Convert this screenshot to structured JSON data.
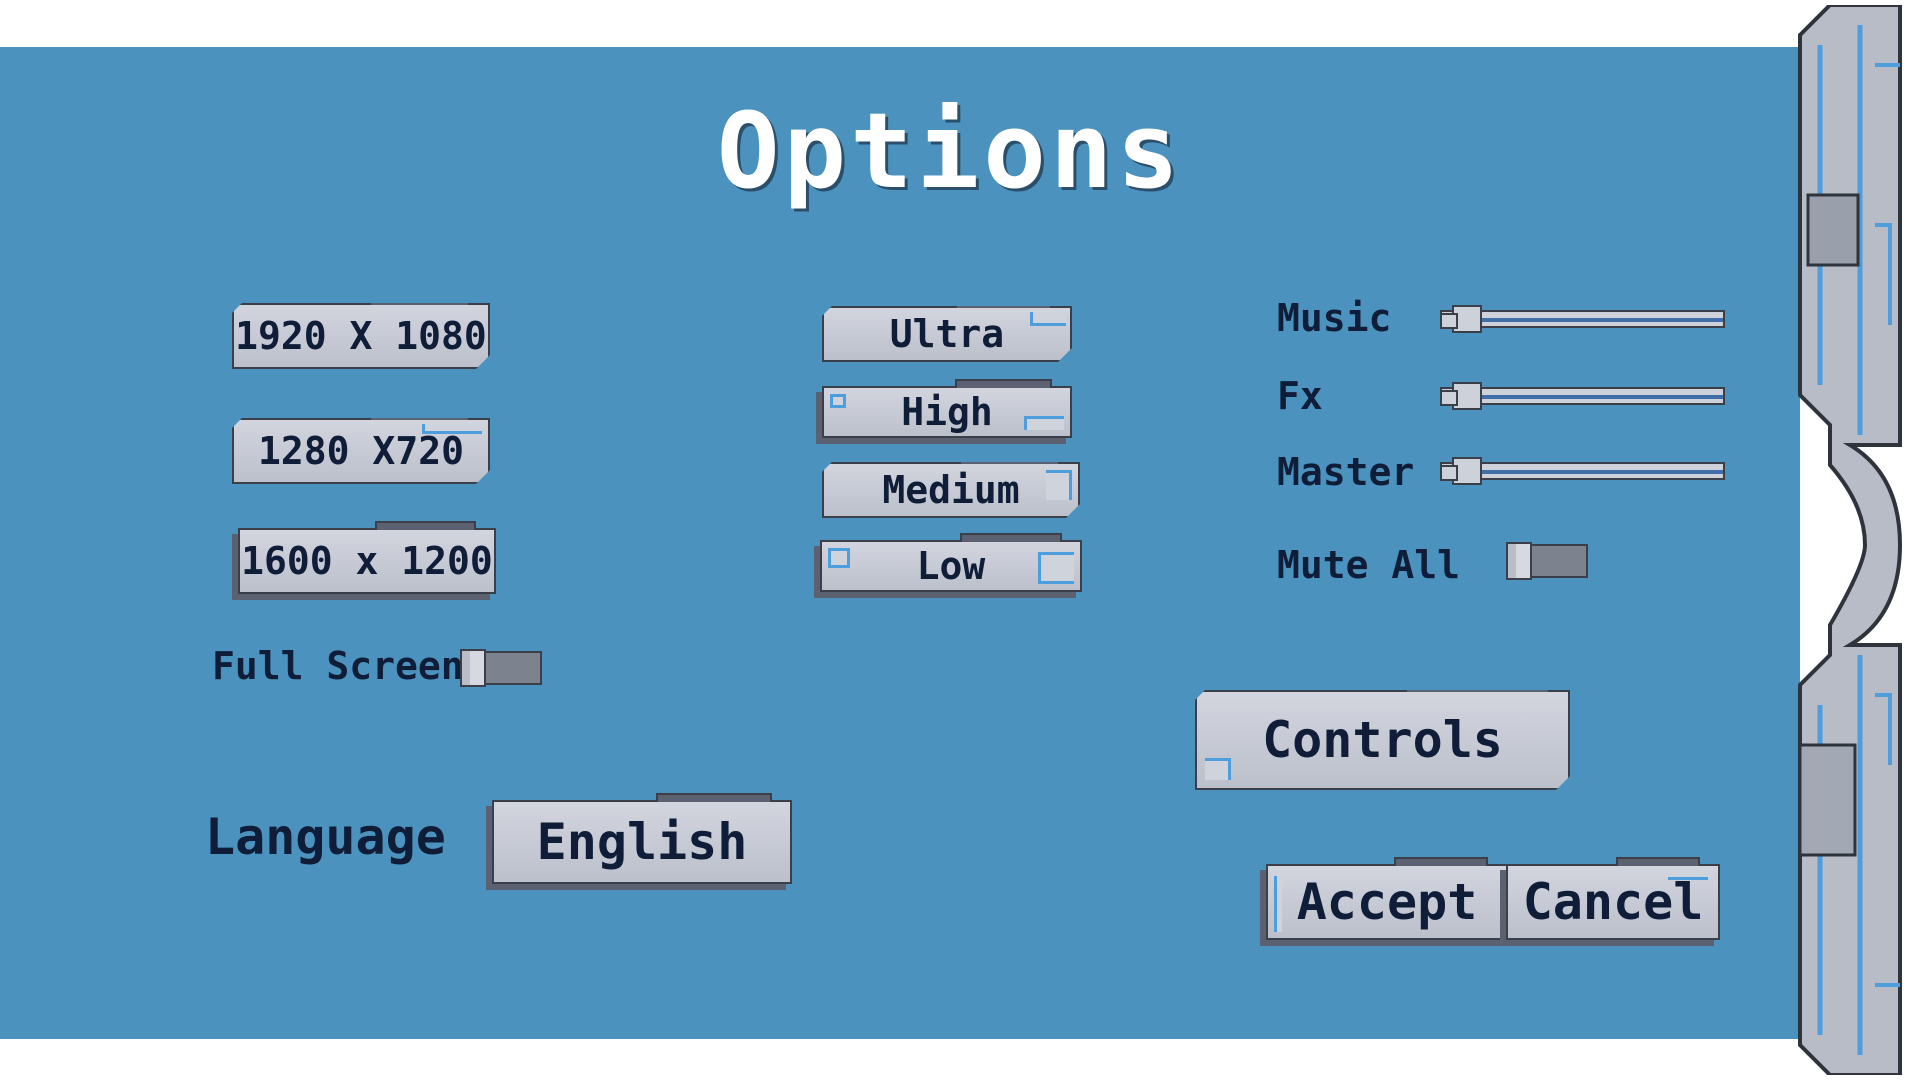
{
  "title": "Options",
  "resolutions": [
    "1920 X 1080",
    "1280 X720",
    "1600 x 1200"
  ],
  "full_screen_label": "Full Screen",
  "quality": [
    "Ultra",
    "High",
    "Medium",
    "Low"
  ],
  "audio": {
    "music_label": "Music",
    "fx_label": "Fx",
    "master_label": "Master",
    "mute_label": "Mute All"
  },
  "language": {
    "label": "Language",
    "value": "English"
  },
  "buttons": {
    "controls": "Controls",
    "accept": "Accept",
    "cancel": "Cancel"
  },
  "colors": {
    "background": "#4b93be",
    "text": "#0f1d38",
    "plate": "#c8ccd6",
    "accent": "#4e9ede"
  }
}
